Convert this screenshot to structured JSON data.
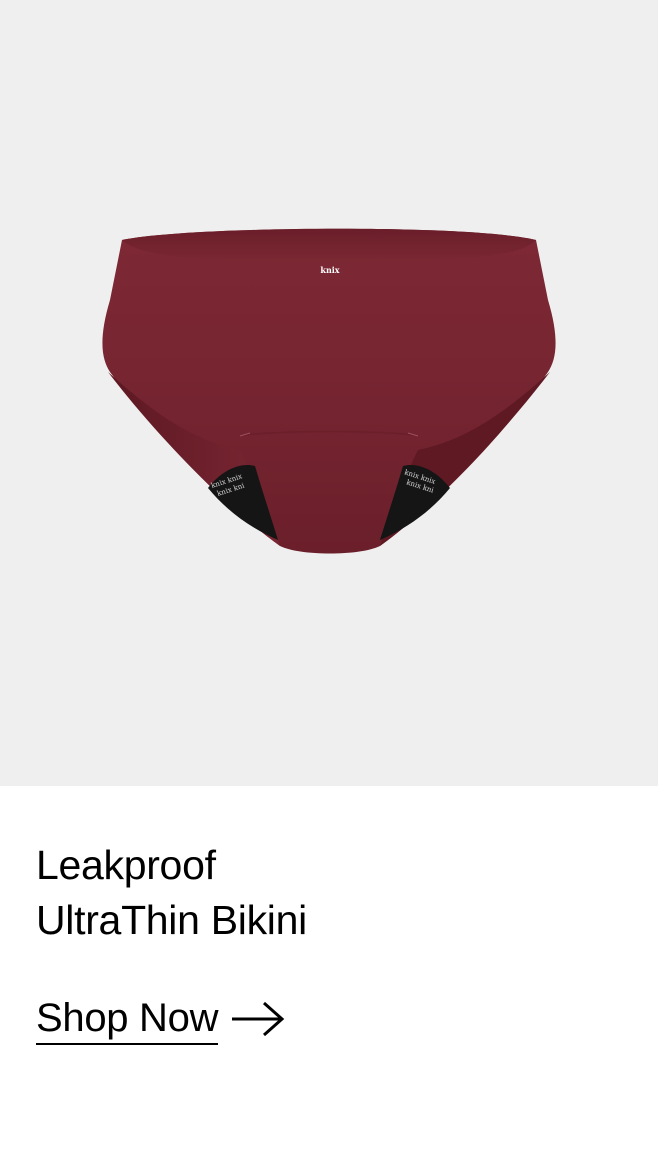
{
  "product": {
    "image_alt": "Leakproof UltraThin Bikini in burgundy",
    "brand_mark": "knix",
    "title_line1": "Leakproof",
    "title_line2": "UltraThin Bikini",
    "color_swatch": "#7a2733"
  },
  "cta": {
    "label": "Shop Now",
    "icon": "arrow-right-icon"
  },
  "colors": {
    "image_background": "#efefef",
    "text": "#000000",
    "page_background": "#ffffff"
  }
}
